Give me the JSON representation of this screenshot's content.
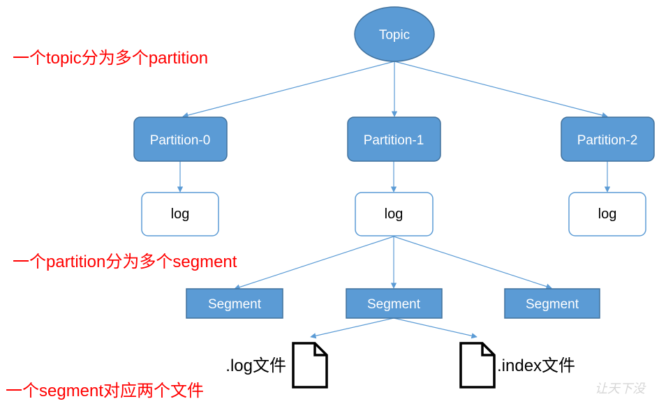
{
  "colors": {
    "node_fill": "#5b9bd5",
    "node_stroke": "#41719c",
    "log_stroke": "#5b9bd5",
    "edge": "#5b9bd5",
    "annotation": "#ff0000"
  },
  "topic": {
    "label": "Topic"
  },
  "partitions": [
    {
      "label": "Partition-0",
      "log_label": "log"
    },
    {
      "label": "Partition-1",
      "log_label": "log"
    },
    {
      "label": "Partition-2",
      "log_label": "log"
    }
  ],
  "segments": [
    {
      "label": "Segment"
    },
    {
      "label": "Segment"
    },
    {
      "label": "Segment"
    }
  ],
  "files": [
    {
      "label": ".log文件",
      "icon": "document-icon"
    },
    {
      "label": ".index文件",
      "icon": "document-icon"
    }
  ],
  "annotations": {
    "topic_to_partition": "一个topic分为多个partition",
    "partition_to_segment": "一个partition分为多个segment",
    "segment_to_files": "一个segment对应两个文件"
  },
  "watermark": "让天下没"
}
